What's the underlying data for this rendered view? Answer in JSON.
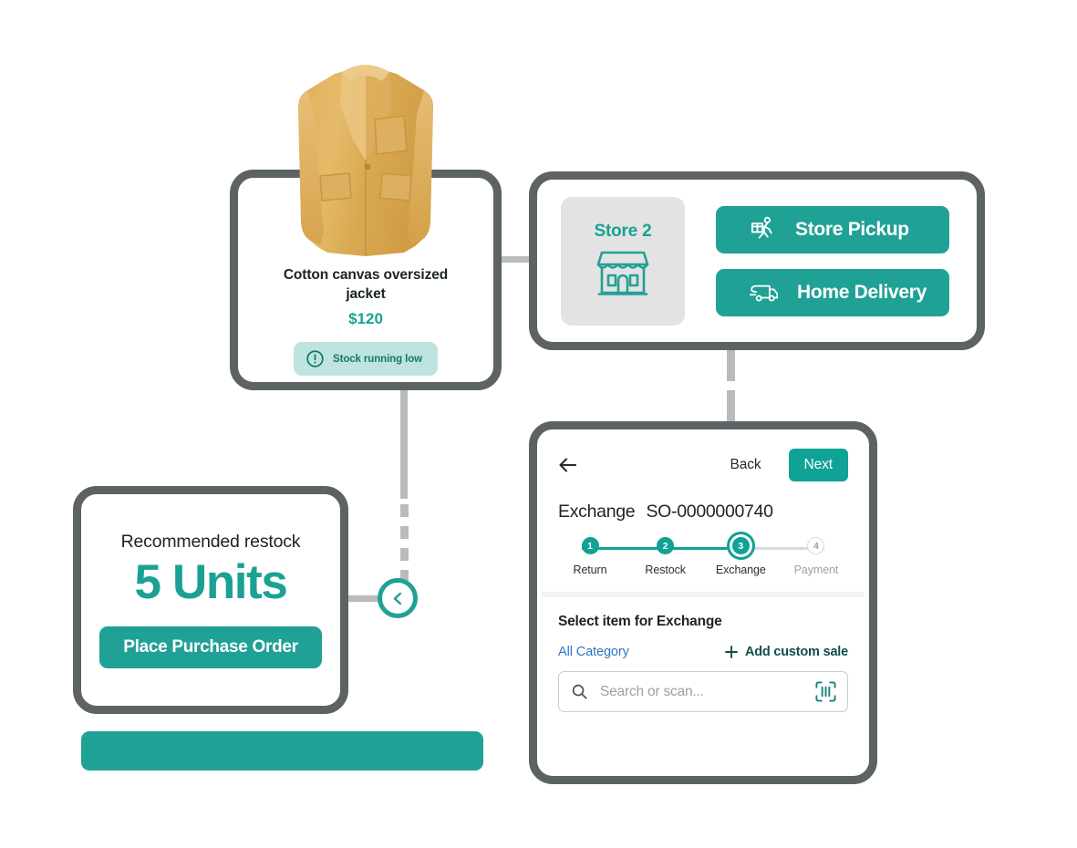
{
  "product_card": {
    "image_alt": "cotton-canvas-oversized-jacket-photo",
    "title": "Cotton canvas oversized jacket",
    "price": "$120",
    "stock_badge": {
      "icon": "alert-circle-icon",
      "label": "Stock running low"
    }
  },
  "store_card": {
    "store_tile": {
      "label": "Store 2",
      "icon": "storefront-icon"
    },
    "actions": [
      {
        "label": "Store Pickup",
        "icon": "person-carrying-box-icon"
      },
      {
        "label": "Home Delivery",
        "icon": "delivery-truck-icon"
      }
    ]
  },
  "restock_card": {
    "label": "Recommended restock",
    "value": "5 Units",
    "button_label": "Place Purchase Order"
  },
  "chevron_node": {
    "icon": "chevron-left-icon"
  },
  "phone_card": {
    "header": {
      "back_arrow_icon": "arrow-left-icon",
      "back_label": "Back",
      "next_label": "Next"
    },
    "heading": "Exchange",
    "order_id": "SO-0000000740",
    "stepper": {
      "steps": [
        {
          "number": "1",
          "label": "Return",
          "state": "done"
        },
        {
          "number": "2",
          "label": "Restock",
          "state": "done"
        },
        {
          "number": "3",
          "label": "Exchange",
          "state": "active"
        },
        {
          "number": "4",
          "label": "Payment",
          "state": "todo"
        }
      ]
    },
    "select_title": "Select item for Exchange",
    "filters": {
      "all_category": "All Category",
      "add_custom_sale": "Add custom sale",
      "add_icon": "plus-icon"
    },
    "search": {
      "icon": "search-icon",
      "value": "",
      "placeholder": "Search or scan...",
      "scan_icon": "barcode-scan-icon"
    }
  },
  "colors": {
    "teal": "#20a195",
    "teal_dark": "#12776d",
    "teal_light": "#bfe4df",
    "frame_gray": "#5d6365",
    "connector_gray": "#b9bcbd",
    "link_blue": "#2d76c9",
    "tile_gray": "#e3e3e3"
  }
}
